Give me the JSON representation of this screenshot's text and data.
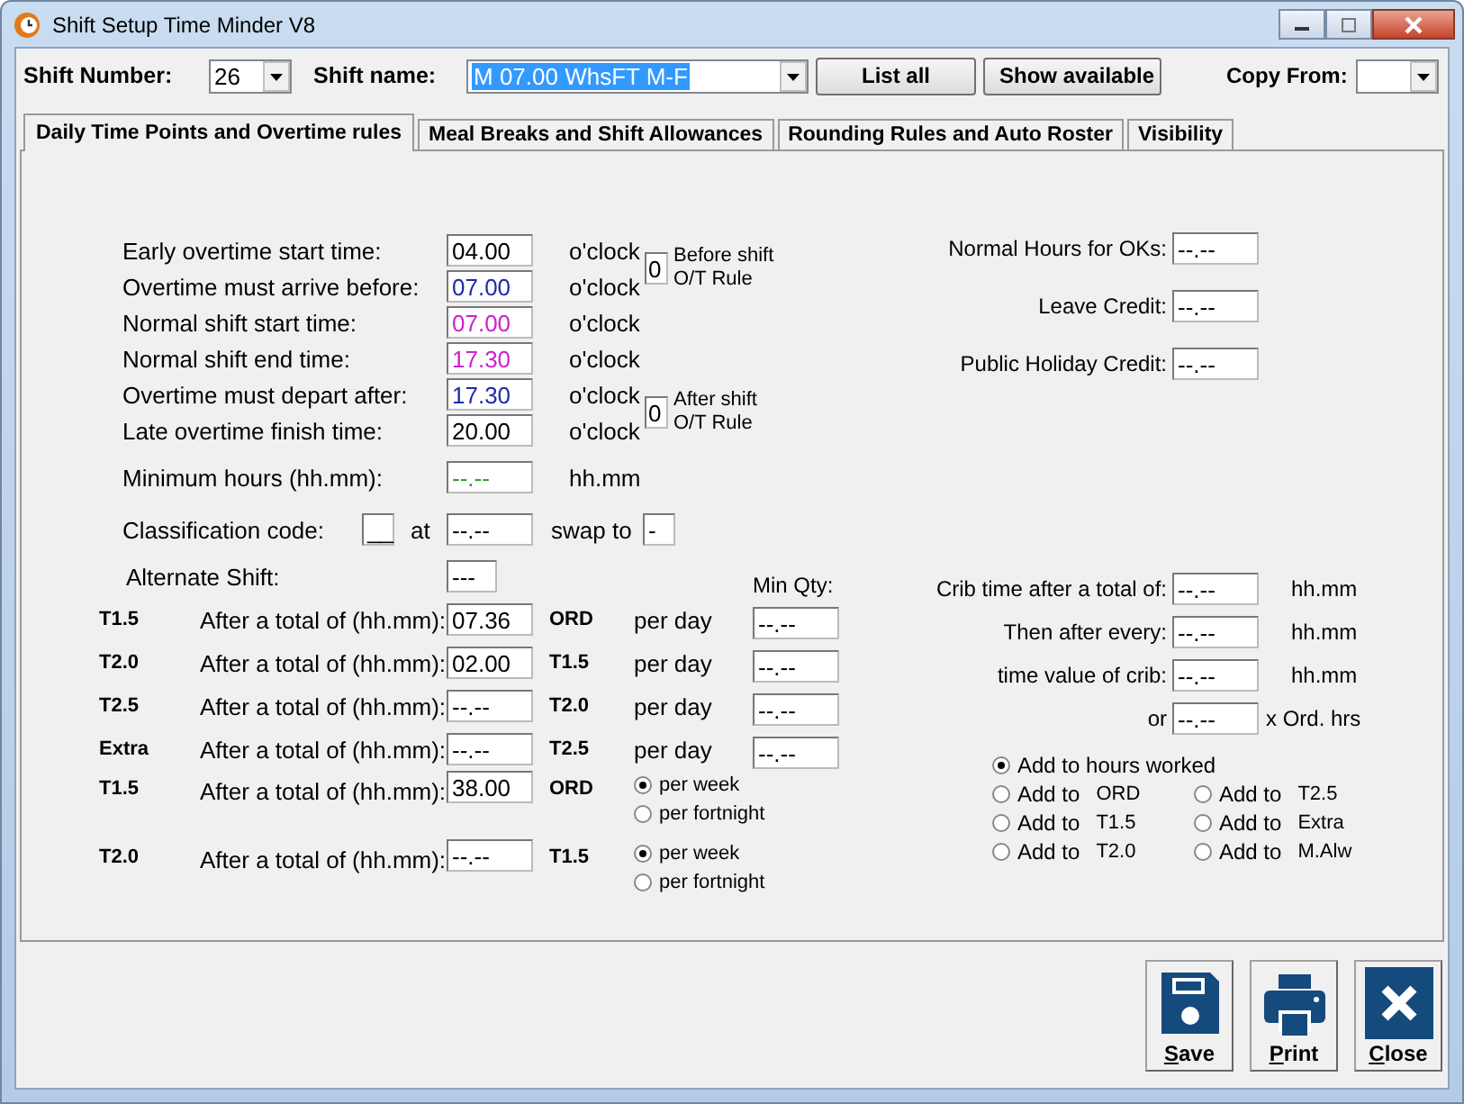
{
  "window": {
    "title": "Shift Setup Time Minder V8"
  },
  "toolbar": {
    "shift_number": {
      "label": "Shift Number:",
      "value": "26"
    },
    "shift_name": {
      "label": "Shift name:",
      "value": "M 07.00 WhsFT M-F",
      "text_selected": true
    },
    "buttons": [
      "List all",
      "Show available"
    ],
    "copy_from": {
      "label": "Copy From:"
    }
  },
  "tabs": [
    {
      "label": "Daily Time Points and Overtime rules",
      "selected": true
    },
    {
      "label": "Meal Breaks and Shift Allowances",
      "selected": false
    },
    {
      "label": "Rounding Rules and Auto Roster",
      "selected": false
    },
    {
      "label": "Visibility",
      "selected": false
    }
  ],
  "time_points": [
    {
      "label": "Early overtime start time:",
      "value": "04.00",
      "color": "#000000",
      "unit": "o'clock"
    },
    {
      "label": "Overtime must arrive before:",
      "value": "07.00",
      "color": "#1c2ca8",
      "unit": "o'clock"
    },
    {
      "label": "Normal shift start time:",
      "value": "07.00",
      "color": "#cc22cc",
      "unit": "o'clock"
    },
    {
      "label": "Normal shift end time:",
      "value": "17.30",
      "color": "#cc22cc",
      "unit": "o'clock"
    },
    {
      "label": "Overtime must depart after:",
      "value": "17.30",
      "color": "#1c2ca8",
      "unit": "o'clock"
    },
    {
      "label": "Late overtime finish time:",
      "value": "20.00",
      "color": "#000000",
      "unit": "o'clock"
    }
  ],
  "ot_rules": [
    {
      "value": "0",
      "label": "Before shift O/T Rule"
    },
    {
      "value": "0",
      "label": "After shift O/T Rule"
    }
  ],
  "minimum_hours": {
    "label": "Minimum hours (hh.mm):",
    "value": "--.--",
    "unit": "hh.mm"
  },
  "classification": {
    "label": "Classification code:",
    "code": "__",
    "at_label": "at",
    "at_value": "--.--",
    "swap_label": "swap to",
    "swap_value": "-"
  },
  "alternate_shift": {
    "label": "Alternate Shift:",
    "value": "---"
  },
  "overtime": {
    "min_qty_label": "Min Qty:",
    "rows": [
      {
        "kind": "daily",
        "rate": "T1.5",
        "label": "After a total of (hh.mm):",
        "value": "07.36",
        "base": "ORD",
        "period": "per day",
        "min_qty": "--.--"
      },
      {
        "kind": "daily",
        "rate": "T2.0",
        "label": "After a total of (hh.mm):",
        "value": "02.00",
        "base": "T1.5",
        "period": "per day",
        "min_qty": "--.--"
      },
      {
        "kind": "daily",
        "rate": "T2.5",
        "label": "After a total of (hh.mm):",
        "value": "--.--",
        "base": "T2.0",
        "period": "per day",
        "min_qty": "--.--"
      },
      {
        "kind": "daily",
        "rate": "Extra",
        "label": "After a total of (hh.mm):",
        "value": "--.--",
        "base": "T2.5",
        "period": "per day",
        "min_qty": "--.--"
      },
      {
        "kind": "periodic",
        "rate": "T1.5",
        "label": "After a total of (hh.mm):",
        "value": "38.00",
        "base": "ORD",
        "options": [
          {
            "label": "per week",
            "selected": true
          },
          {
            "label": "per fortnight",
            "selected": false
          }
        ]
      },
      {
        "kind": "periodic",
        "rate": "T2.0",
        "label": "After a total of (hh.mm):",
        "value": "--.--",
        "base": "T1.5",
        "options": [
          {
            "label": "per week",
            "selected": true
          },
          {
            "label": "per fortnight",
            "selected": false
          }
        ]
      }
    ]
  },
  "credits": [
    {
      "label": "Normal Hours for OKs:",
      "value": "--.--"
    },
    {
      "label": "Leave Credit:",
      "value": "--.--"
    },
    {
      "label": "Public Holiday Credit:",
      "value": "--.--"
    }
  ],
  "crib": [
    {
      "label": "Crib time after a total of:",
      "value": "--.--",
      "unit": "hh.mm"
    },
    {
      "label": "Then after every:",
      "value": "--.--",
      "unit": "hh.mm"
    },
    {
      "label": "time value of crib:",
      "value": "--.--",
      "unit": "hh.mm"
    },
    {
      "label": "or",
      "value": "--.--",
      "unit": "x Ord. hrs"
    }
  ],
  "crib_add": [
    {
      "label": "Add to hours worked",
      "selected": true
    },
    {
      "label": "Add to",
      "target": "ORD",
      "selected": false
    },
    {
      "label": "Add to",
      "target": "T2.5",
      "selected": false
    },
    {
      "label": "Add to",
      "target": "T1.5",
      "selected": false
    },
    {
      "label": "Add to",
      "target": "Extra",
      "selected": false
    },
    {
      "label": "Add to",
      "target": "T2.0",
      "selected": false
    },
    {
      "label": "Add to",
      "target": "M.Alw",
      "selected": false
    }
  ],
  "actions": [
    {
      "label": "Save",
      "kind": "save"
    },
    {
      "label": "Print",
      "kind": "print"
    },
    {
      "label": "Close",
      "kind": "close"
    }
  ]
}
